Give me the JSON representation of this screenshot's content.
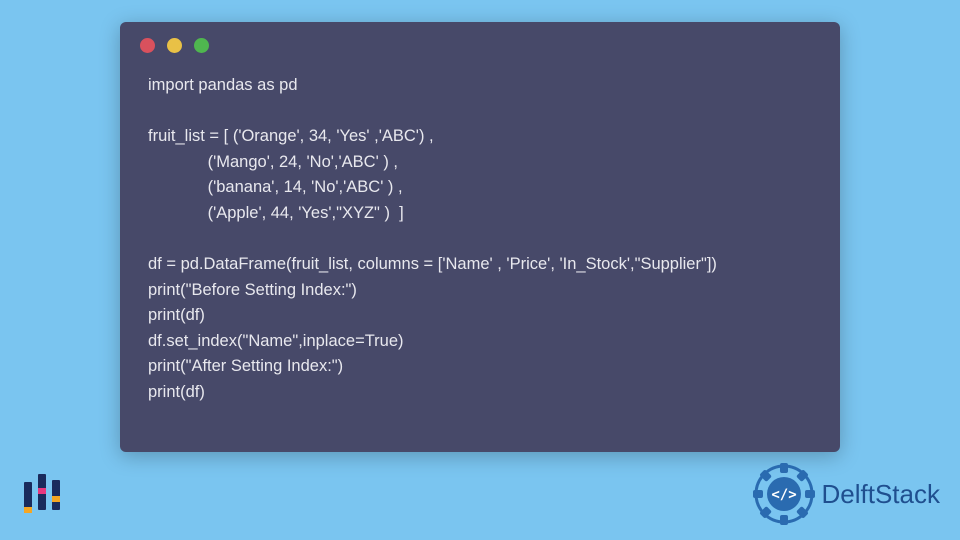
{
  "window": {
    "controls": [
      "red",
      "yellow",
      "green"
    ]
  },
  "code": {
    "line1": "import pandas as pd",
    "line2": "",
    "line3": "fruit_list = [ ('Orange', 34, 'Yes' ,'ABC') ,",
    "line4": "             ('Mango', 24, 'No','ABC' ) ,",
    "line5": "             ('banana', 14, 'No','ABC' ) ,",
    "line6": "             ('Apple', 44, 'Yes',\"XYZ\" )  ]",
    "line7": "",
    "line8": "df = pd.DataFrame(fruit_list, columns = ['Name' , 'Price', 'In_Stock',\"Supplier\"])",
    "line9": "print(\"Before Setting Index:\")",
    "line10": "print(df)",
    "line11": "df.set_index(\"Name\",inplace=True)",
    "line12": "print(\"After Setting Index:\")",
    "line13": "print(df)"
  },
  "branding": {
    "name": "DelftStack"
  }
}
